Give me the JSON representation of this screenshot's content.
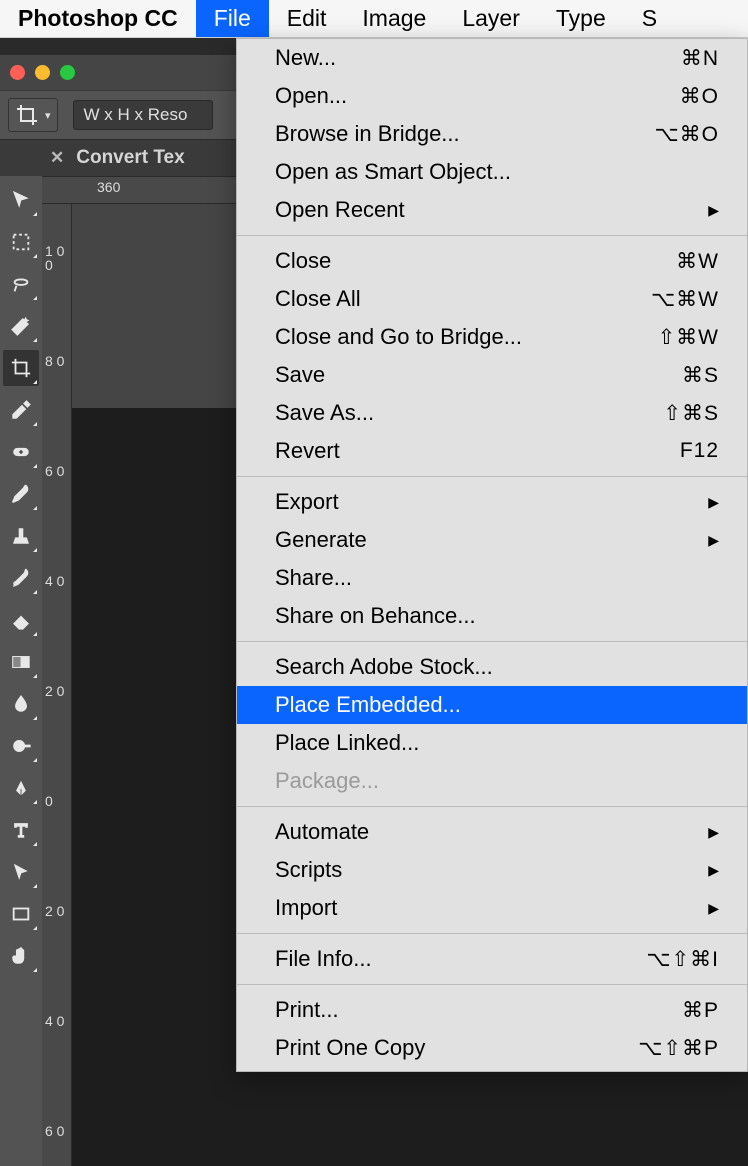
{
  "menubar": {
    "app_title": "Photoshop CC",
    "items": [
      "File",
      "Edit",
      "Image",
      "Layer",
      "Type",
      "S"
    ],
    "selected_index": 0
  },
  "optionsbar": {
    "preset_label": "W x H x Reso"
  },
  "doc_tab": {
    "label": "Convert Tex"
  },
  "ruler_h": {
    "ticks": [
      "360"
    ]
  },
  "ruler_v": {
    "ticks": [
      "1\n0\n0",
      "8\n0",
      "6\n0",
      "4\n0",
      "2\n0",
      "0",
      "2\n0",
      "4\n0",
      "6\n0"
    ]
  },
  "dropdown": {
    "groups": [
      [
        {
          "label": "New...",
          "shortcut": "⌘N"
        },
        {
          "label": "Open...",
          "shortcut": "⌘O"
        },
        {
          "label": "Browse in Bridge...",
          "shortcut": "⌥⌘O"
        },
        {
          "label": "Open as Smart Object..."
        },
        {
          "label": "Open Recent",
          "submenu": true
        }
      ],
      [
        {
          "label": "Close",
          "shortcut": "⌘W"
        },
        {
          "label": "Close All",
          "shortcut": "⌥⌘W"
        },
        {
          "label": "Close and Go to Bridge...",
          "shortcut": "⇧⌘W"
        },
        {
          "label": "Save",
          "shortcut": "⌘S"
        },
        {
          "label": "Save As...",
          "shortcut": "⇧⌘S"
        },
        {
          "label": "Revert",
          "shortcut": "F12"
        }
      ],
      [
        {
          "label": "Export",
          "submenu": true
        },
        {
          "label": "Generate",
          "submenu": true
        },
        {
          "label": "Share..."
        },
        {
          "label": "Share on Behance..."
        }
      ],
      [
        {
          "label": "Search Adobe Stock..."
        },
        {
          "label": "Place Embedded...",
          "highlight": true
        },
        {
          "label": "Place Linked..."
        },
        {
          "label": "Package...",
          "disabled": true
        }
      ],
      [
        {
          "label": "Automate",
          "submenu": true
        },
        {
          "label": "Scripts",
          "submenu": true
        },
        {
          "label": "Import",
          "submenu": true
        }
      ],
      [
        {
          "label": "File Info...",
          "shortcut": "⌥⇧⌘I"
        }
      ],
      [
        {
          "label": "Print...",
          "shortcut": "⌘P"
        },
        {
          "label": "Print One Copy",
          "shortcut": "⌥⇧⌘P"
        }
      ]
    ]
  }
}
